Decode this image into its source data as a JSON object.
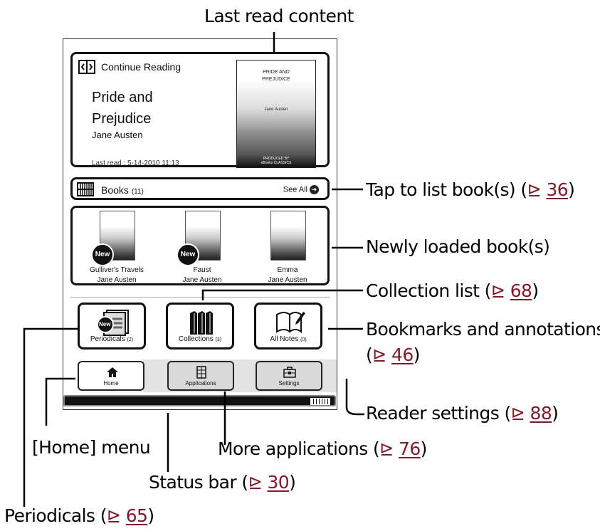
{
  "callouts": {
    "last_read": "Last read content",
    "tap_list": "Tap to list book(s)",
    "tap_list_ref": "36",
    "newly_loaded": "Newly loaded book(s)",
    "collection_list": "Collection list",
    "collection_ref": "68",
    "bookmarks": "Bookmarks and annotations",
    "bookmarks_ref": "46",
    "reader_settings": "Reader settings",
    "reader_settings_ref": "88",
    "home_menu": "[Home] menu",
    "more_apps": "More applications",
    "more_apps_ref": "76",
    "status_bar": "Status bar",
    "status_bar_ref": "30",
    "periodicals": "Periodicals",
    "periodicals_ref": "65",
    "ref_symbol": "⊵"
  },
  "continue_reading": {
    "label": "Continue Reading",
    "title": "Pride and Prejudice",
    "author": "Jane Austen",
    "last_read": "Last read : 5-14-2010 11:13",
    "cover_title": "PRIDE AND PREJUDICE",
    "cover_dots": "· · ·",
    "cover_author": "Jane Austen",
    "cover_publisher_1": "PRODUCED BY",
    "cover_publisher_2": "eBooks CLASSICS"
  },
  "books_bar": {
    "label": "Books",
    "count": "(11)",
    "see_all": "See All"
  },
  "new_books": [
    {
      "title": "Gulliver's Travels",
      "author": "Jane Austen",
      "badge": "New"
    },
    {
      "title": "Faust",
      "author": "Jane Austen",
      "badge": "New"
    },
    {
      "title": "Emma",
      "author": "Jane Austen",
      "badge": ""
    }
  ],
  "tiles": [
    {
      "label": "Periodicals",
      "count": "(2)",
      "badge": "New"
    },
    {
      "label": "Collections",
      "count": "(3)"
    },
    {
      "label": "All Notes",
      "count": "(0)"
    }
  ],
  "tabs": [
    {
      "label": "Home"
    },
    {
      "label": "Applications"
    },
    {
      "label": "Settings"
    }
  ],
  "colors": {
    "ref": "#7d1b2a",
    "frame": "#111111"
  }
}
